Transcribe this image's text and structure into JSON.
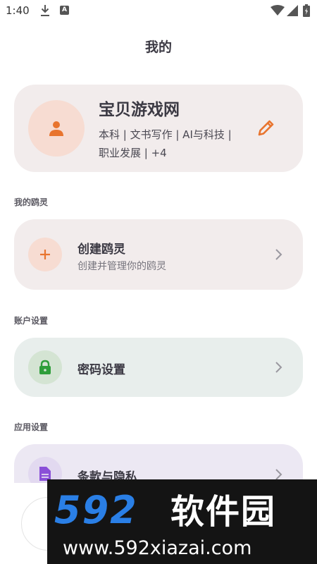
{
  "status_bar": {
    "time": "1:40",
    "a_badge": "A"
  },
  "header": {
    "title": "我的"
  },
  "profile": {
    "name": "宝贝游戏网",
    "tags_line1": "本科 | 文书写作 | AI与科技 |",
    "tags_line2": "职业发展 | +4",
    "avatar_icon": "person-icon",
    "edit_icon": "pencil-icon"
  },
  "sections": {
    "my_agents": "我的鸥灵",
    "account_settings": "账户设置",
    "app_settings": "应用设置"
  },
  "create_agent": {
    "title": "创建鸥灵",
    "subtitle": "创建并管理你的鸥灵"
  },
  "password": {
    "title": "密码设置"
  },
  "terms": {
    "title": "条款与隐私"
  },
  "watermark": {
    "logo_num": "592",
    "logo_cn": "软件园",
    "url": "www.592xiazai.com"
  },
  "colors": {
    "accent_orange": "#e8742e",
    "accent_green": "#2e9e3a",
    "accent_purple": "#8a4fd8",
    "watermark_blue": "#2a7fe6"
  }
}
